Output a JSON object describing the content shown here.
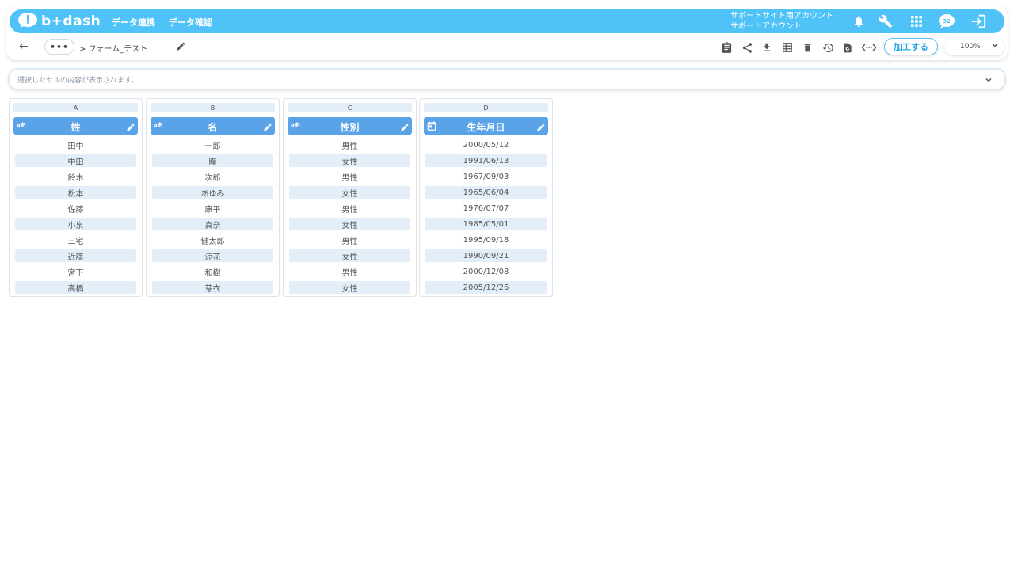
{
  "navbar": {
    "logo_text": "b+dash",
    "links": [
      "データ連携",
      "データ確認"
    ],
    "account_line1": "サポートサイト用アカウント",
    "account_line2": "サポートアカウント",
    "badge": "32",
    "icons": [
      "bell-icon",
      "wrench-icon",
      "apps-grid-icon",
      "chat-icon",
      "logout-icon"
    ]
  },
  "subbar": {
    "back": "←",
    "ellipsis": "•••",
    "breadcrumb": "> フォーム_テスト",
    "process_button": "加工する",
    "zoom": "100%",
    "tools": [
      "clipboard-icon",
      "share-icon",
      "download-icon",
      "table-view-icon",
      "delete-icon",
      "history-icon",
      "restore-icon",
      "code-icon"
    ]
  },
  "cell_viewer": {
    "placeholder": "選択したセルの内容が表示されます。"
  },
  "columns": [
    {
      "letter": "A",
      "type": "text",
      "type_label": "aあ",
      "name": "姓",
      "cells": [
        "田中",
        "中田",
        "鈴木",
        "松本",
        "佐藤",
        "小泉",
        "三宅",
        "近藤",
        "宮下",
        "高橋"
      ]
    },
    {
      "letter": "B",
      "type": "text",
      "type_label": "aあ",
      "name": "名",
      "cells": [
        "一郎",
        "瞳",
        "次郎",
        "あゆみ",
        "康平",
        "真奈",
        "健太郎",
        "涼花",
        "和樹",
        "芽衣"
      ]
    },
    {
      "letter": "C",
      "type": "text",
      "type_label": "aあ",
      "name": "性別",
      "cells": [
        "男性",
        "女性",
        "男性",
        "女性",
        "男性",
        "女性",
        "男性",
        "女性",
        "男性",
        "女性"
      ]
    },
    {
      "letter": "D",
      "type": "date",
      "type_label": "",
      "name": "生年月日",
      "cells": [
        "2000/05/12",
        "1991/06/13",
        "1967/09/03",
        "1965/06/04",
        "1976/07/07",
        "1985/05/01",
        "1995/09/18",
        "1990/09/21",
        "2000/12/08",
        "2005/12/26"
      ]
    }
  ],
  "colors": {
    "primary": "#4fc3f7",
    "header": "#5aa3e8",
    "row_alt": "#e3eef9"
  }
}
